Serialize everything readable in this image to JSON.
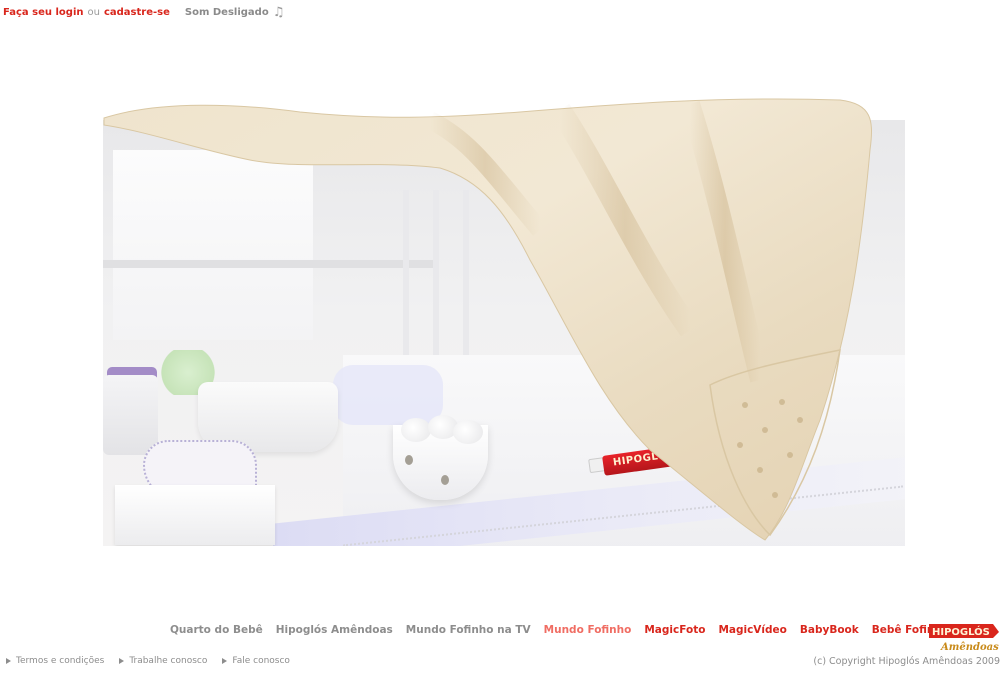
{
  "topbar": {
    "login_label": "Faça seu login",
    "or_label": "ou",
    "signup_label": "cadastre-se",
    "sound_label": "Som Desligado",
    "sound_icon": "music-note-icon"
  },
  "hero": {
    "tube_label": "HIPOGLÓ"
  },
  "nav": {
    "items": [
      {
        "label": "Quarto do Bebê"
      },
      {
        "label": "Hipoglós Amêndoas"
      },
      {
        "label": "Mundo Fofinho na TV"
      },
      {
        "label": "Mundo Fofinho"
      },
      {
        "label": "MagicFoto"
      },
      {
        "label": "MagicVídeo"
      },
      {
        "label": "BabyBook"
      },
      {
        "label": "Bebê Fofinho"
      }
    ]
  },
  "logo": {
    "brand": "Hipoglós",
    "sub": "Amêndoas"
  },
  "footer": {
    "links": [
      {
        "label": "Termos e condições"
      },
      {
        "label": "Trabalhe conosco"
      },
      {
        "label": "Fale conosco"
      }
    ],
    "copyright": "(c) Copyright Hipoglós Amêndoas 2009"
  },
  "colors": {
    "accent_red": "#d9261c",
    "light_red": "#f06d63",
    "gray_text": "#8d8d8d",
    "blanket": "#eadcc2"
  }
}
